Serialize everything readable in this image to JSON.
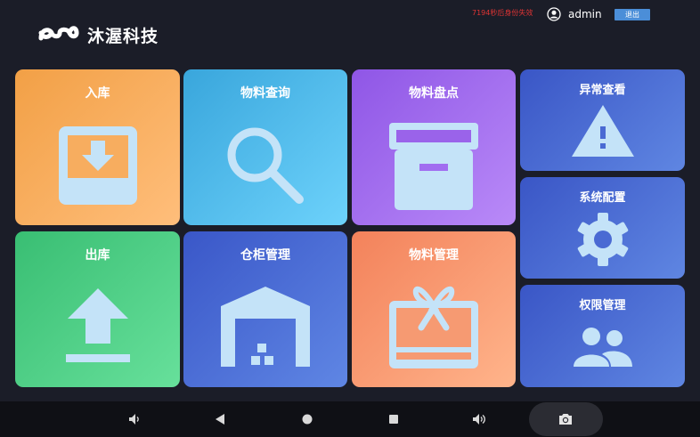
{
  "header": {
    "brand": "沐渥科技",
    "session_text": "7194秒后身份失效",
    "username": "admin",
    "logout_label": "退出"
  },
  "tiles": {
    "inbound": "入库",
    "query": "物料查询",
    "stocktake": "物料盘点",
    "outbound": "出库",
    "cabinet": "仓柜管理",
    "material": "物料管理",
    "exception": "异常查看",
    "settings": "系统配置",
    "permission": "权限管理"
  },
  "icons": {
    "logo": "wave-logo-icon",
    "user": "user-icon",
    "inbound": "inbox-download-icon",
    "query": "search-icon",
    "stocktake": "archive-box-icon",
    "outbound": "upload-icon",
    "cabinet": "warehouse-icon",
    "material": "gift-box-icon",
    "exception": "warning-icon",
    "settings": "gear-icon",
    "permission": "users-icon"
  },
  "navbar": {
    "buttons": [
      "volume-down-icon",
      "back-icon",
      "home-icon",
      "recents-icon",
      "volume-up-icon",
      "camera-icon"
    ]
  },
  "colors": {
    "icon_fill": "#c4e3f8",
    "session_text": "#e23434",
    "logout_bg": "#4b8ed8"
  }
}
